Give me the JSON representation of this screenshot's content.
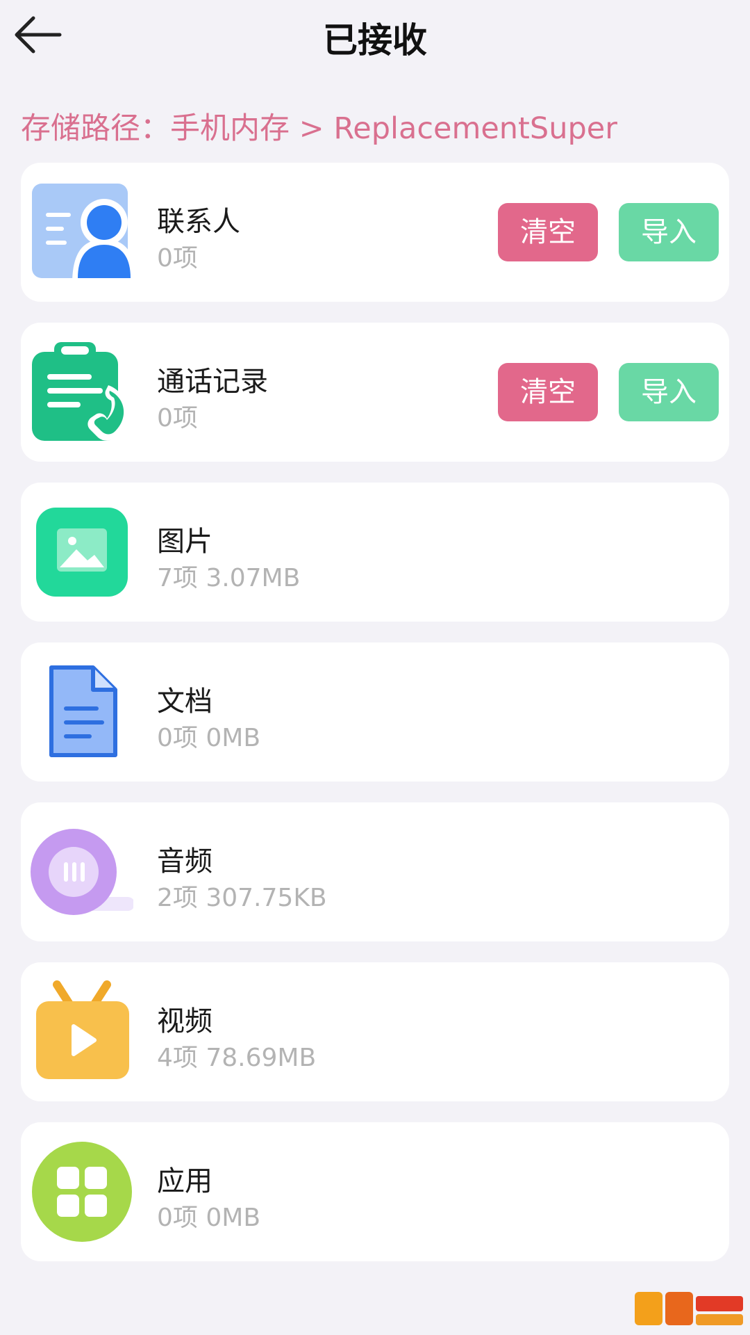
{
  "header": {
    "title": "已接收"
  },
  "storage_path": "存储路径：手机内存 > ReplacementSuper",
  "items": [
    {
      "name": "联系人",
      "meta": "0项",
      "icon": "contacts-icon",
      "clear_label": "清空",
      "import_label": "导入"
    },
    {
      "name": "通话记录",
      "meta": "0项",
      "icon": "call-log-icon",
      "clear_label": "清空",
      "import_label": "导入"
    },
    {
      "name": "图片",
      "meta": "7项  3.07MB",
      "icon": "image-icon"
    },
    {
      "name": "文档",
      "meta": "0项  0MB",
      "icon": "document-icon"
    },
    {
      "name": "音频",
      "meta": "2项  307.75KB",
      "icon": "audio-icon"
    },
    {
      "name": "视频",
      "meta": "4项  78.69MB",
      "icon": "video-icon"
    },
    {
      "name": "应用",
      "meta": "0项  0MB",
      "icon": "apps-icon"
    }
  ],
  "colors": {
    "background": "#f3f2f7",
    "path_text": "#d9708f",
    "clear_button": "#e2688b",
    "import_button": "#69d8a5"
  }
}
